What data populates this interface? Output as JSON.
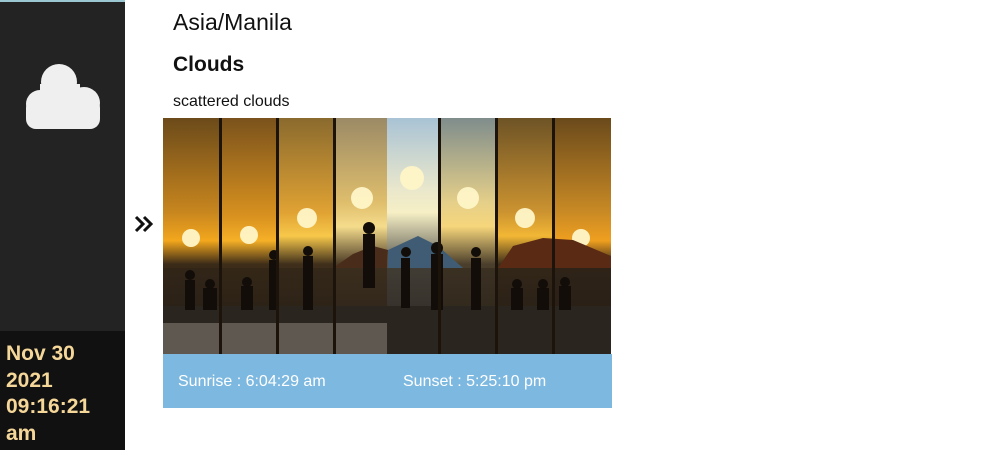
{
  "sidebar": {
    "icon": "cloud-icon",
    "date_line1": "Nov 30",
    "date_line2": "2021",
    "time_line1": "09:16:21",
    "time_line2": "am"
  },
  "main": {
    "location": "Asia/Manila",
    "weather_main": "Clouds",
    "weather_description": "scattered clouds",
    "toggle_icon": "double-chevron-right-icon",
    "sunrise_text": "Sunrise : 6:04:29 am",
    "sunset_text": "Sunset : 5:25:10 pm"
  },
  "colors": {
    "sidebar_bg": "#232323",
    "datetime_bg": "#111111",
    "datetime_text": "#f6d79a",
    "info_bar_bg": "#7db8e0"
  }
}
